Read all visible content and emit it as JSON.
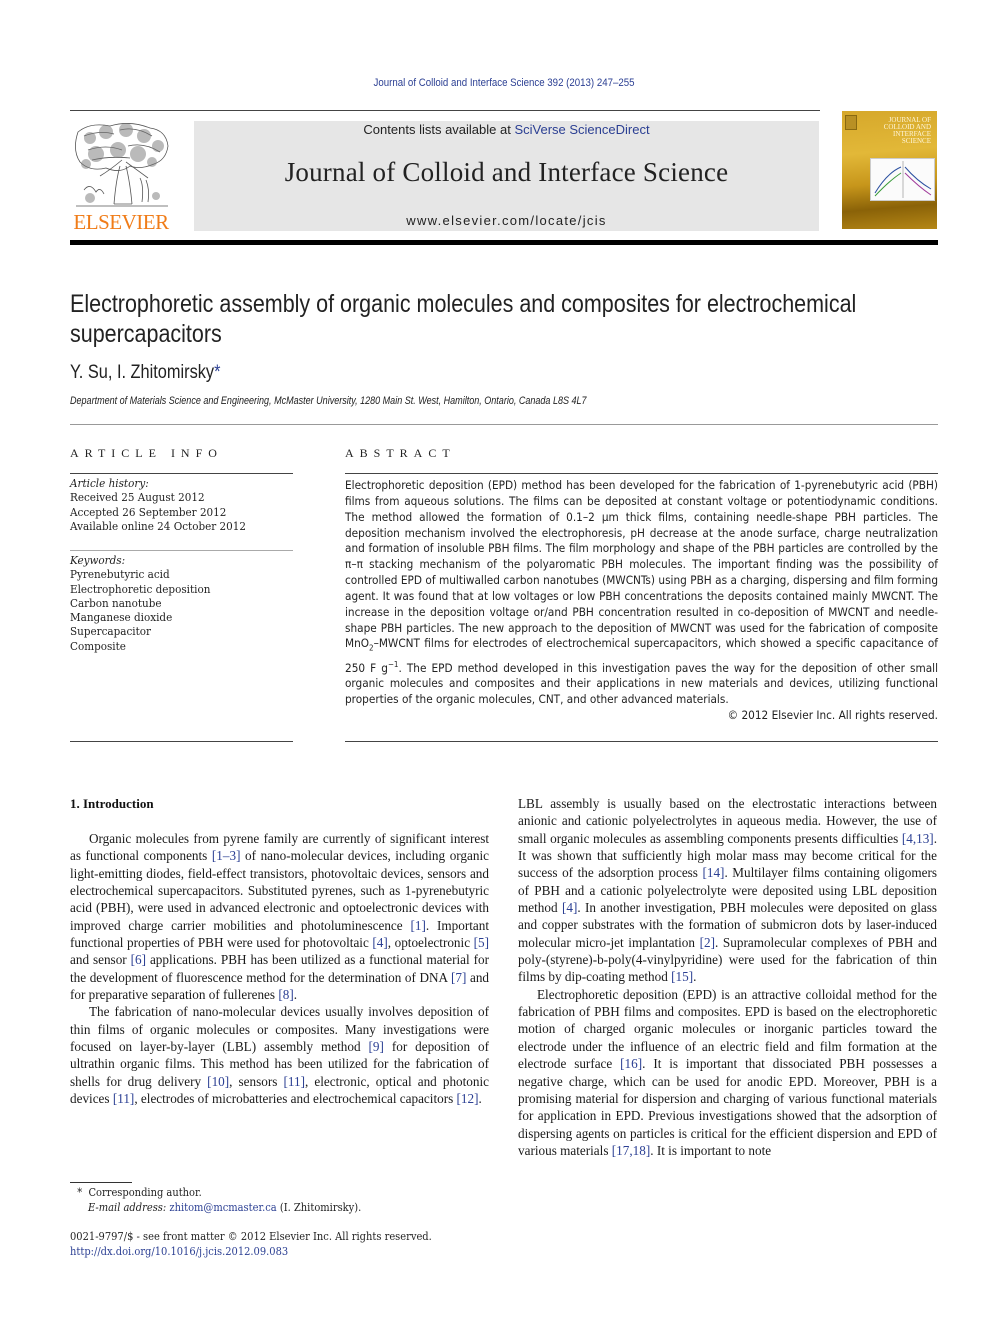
{
  "header": {
    "journal_ref": "Journal of Colloid and Interface Science 392 (2013) 247–255",
    "publisher_logo_text": "ELSEVIER",
    "contents_prefix": "Contents lists available at ",
    "contents_link": "SciVerse ScienceDirect",
    "journal_title": "Journal of Colloid and Interface Science",
    "journal_url": "www.elsevier.com/locate/jcis",
    "cover_title_lines": [
      "JOURNAL OF",
      "COLLOID AND",
      "INTERFACE",
      "SCIENCE"
    ]
  },
  "article": {
    "title_line1": "Electrophoretic assembly of organic molecules and composites for electrochemical",
    "title_line2": "supercapacitors",
    "authors": "Y. Su, I. Zhitomirsky",
    "author_marker": "*",
    "affiliation": "Department of Materials Science and Engineering, McMaster University, 1280 Main St. West, Hamilton, Ontario, Canada L8S 4L7"
  },
  "article_info": {
    "heading": "ARTICLE INFO",
    "history_label": "Article history:",
    "history": [
      "Received 25 August 2012",
      "Accepted 26 September 2012",
      "Available online 24 October 2012"
    ],
    "keywords_label": "Keywords:",
    "keywords": [
      "Pyrenebutyric acid",
      "Electrophoretic deposition",
      "Carbon nanotube",
      "Manganese dioxide",
      "Supercapacitor",
      "Composite"
    ]
  },
  "abstract": {
    "heading": "ABSTRACT",
    "text_part1": "Electrophoretic deposition (EPD) method has been developed for the fabrication of 1-pyrenebutyric acid (PBH) films from aqueous solutions. The films can be deposited at constant voltage or potentiodynamic conditions. The method allowed the formation of 0.1–2 µm thick films, containing needle-shape PBH particles. The deposition mechanism involved the electrophoresis, pH decrease at the anode surface, charge neutralization and formation of insoluble PBH films. The film morphology and shape of the PBH particles are controlled by the π–π stacking mechanism of the polyaromatic PBH molecules. The important finding was the possibility of controlled EPD of multiwalled carbon nanotubes (MWCNTs) using PBH as a charging, dispersing and film forming agent. It was found that at low voltages or low PBH concentrations the deposits contained mainly MWCNT. The increase in the deposition voltage or/and PBH concentration resulted in co-deposition of MWCNT and needle-shape PBH particles. The new approach to the deposition of MWCNT was used for the fabrication of composite MnO",
    "subscript": "2",
    "text_part2": "–MWCNT films for electrodes of electrochemical supercapacitors, which showed a specific capacitance of 250 F g",
    "superscript": "−1",
    "text_part3": ". The EPD method developed in this investigation paves the way for the deposition of other small organic molecules and composites and their applications in new materials and devices, utilizing functional properties of the organic molecules, CNT, and other advanced materials.",
    "copyright": "© 2012 Elsevier Inc. All rights reserved."
  },
  "body": {
    "section_heading": "1. Introduction",
    "left": {
      "p1": [
        {
          "t": "Organic molecules from pyrene family are currently of significant interest as functional components "
        },
        {
          "ref": "[1–3]"
        },
        {
          "t": " of nano-molecular devices, including organic light-emitting diodes, field-effect transistors, photovoltaic devices, sensors and electrochemical supercapacitors. Substituted pyrenes, such as 1-pyrenebutyric acid (PBH), were used in advanced electronic and optoelectronic devices with improved charge carrier mobilities and photoluminescence "
        },
        {
          "ref": "[1]"
        },
        {
          "t": ". Important functional properties of PBH were used for photovoltaic "
        },
        {
          "ref": "[4]"
        },
        {
          "t": ", optoelectronic "
        },
        {
          "ref": "[5]"
        },
        {
          "t": " and sensor "
        },
        {
          "ref": "[6]"
        },
        {
          "t": " applications. PBH has been utilized as a functional material for the development of fluorescence method for the determination of DNA "
        },
        {
          "ref": "[7]"
        },
        {
          "t": " and for preparative separation of fullerenes "
        },
        {
          "ref": "[8]"
        },
        {
          "t": "."
        }
      ],
      "p2": [
        {
          "t": "The fabrication of nano-molecular devices usually involves deposition of thin films of organic molecules or composites. Many investigations were focused on layer-by-layer (LBL) assembly method "
        },
        {
          "ref": "[9]"
        },
        {
          "t": " for deposition of ultrathin organic films. This method has been utilized for the fabrication of shells for drug delivery "
        },
        {
          "ref": "[10]"
        },
        {
          "t": ", sensors "
        },
        {
          "ref": "[11]"
        },
        {
          "t": ", electronic, optical and photonic devices "
        },
        {
          "ref": "[11]"
        },
        {
          "t": ", electrodes of microbatteries and electrochemical capacitors "
        },
        {
          "ref": "[12]"
        },
        {
          "t": "."
        }
      ]
    },
    "right": {
      "p1": [
        {
          "t": "LBL assembly is usually based on the electrostatic interactions between anionic and cationic polyelectrolytes in aqueous media. However, the use of small organic molecules as assembling components presents difficulties "
        },
        {
          "ref": "[4,13]"
        },
        {
          "t": ". It was shown that sufficiently high molar mass may become critical for the success of the adsorption process "
        },
        {
          "ref": "[14]"
        },
        {
          "t": ". Multilayer films containing oligomers of PBH and a cationic polyelectrolyte were deposited using LBL deposition method "
        },
        {
          "ref": "[4]"
        },
        {
          "t": ". In another investigation, PBH molecules were deposited on glass and copper substrates with the formation of submicron dots by laser-induced molecular micro-jet implantation "
        },
        {
          "ref": "[2]"
        },
        {
          "t": ". Supramolecular complexes of PBH and poly-(styrene)-b-poly(4-vinylpyridine) were used for the fabrication of thin films by dip-coating method "
        },
        {
          "ref": "[15]"
        },
        {
          "t": "."
        }
      ],
      "p2": [
        {
          "t": "Electrophoretic deposition (EPD) is an attractive colloidal method for the fabrication of PBH films and composites. EPD is based on the electrophoretic motion of charged organic molecules or inorganic particles toward the electrode under the influence of an electric field and film formation at the electrode surface "
        },
        {
          "ref": "[16]"
        },
        {
          "t": ". It is important that dissociated PBH possesses a negative charge, which can be used for anodic EPD. Moreover, PBH is a promising material for dispersion and charging of various functional materials for application in EPD. Previous investigations showed that the adsorption of dispersing agents on particles is critical for the efficient dispersion and EPD of various materials "
        },
        {
          "ref": "[17,18]"
        },
        {
          "t": ". It is important to note"
        }
      ]
    }
  },
  "footnote": {
    "marker": "*",
    "corresponding": "Corresponding author.",
    "email_label": "E-mail address:",
    "email": "zhitom@mcmaster.ca",
    "email_owner": " (I. Zhitomirsky)."
  },
  "front_matter": {
    "issn_line": "0021-9797/$ - see front matter © 2012 Elsevier Inc. All rights reserved.",
    "doi": "http://dx.doi.org/10.1016/j.jcis.2012.09.083"
  },
  "colors": {
    "link": "#2b3f93",
    "elsevier_orange": "#f07c18",
    "banner_bg": "#e6e6e6"
  }
}
